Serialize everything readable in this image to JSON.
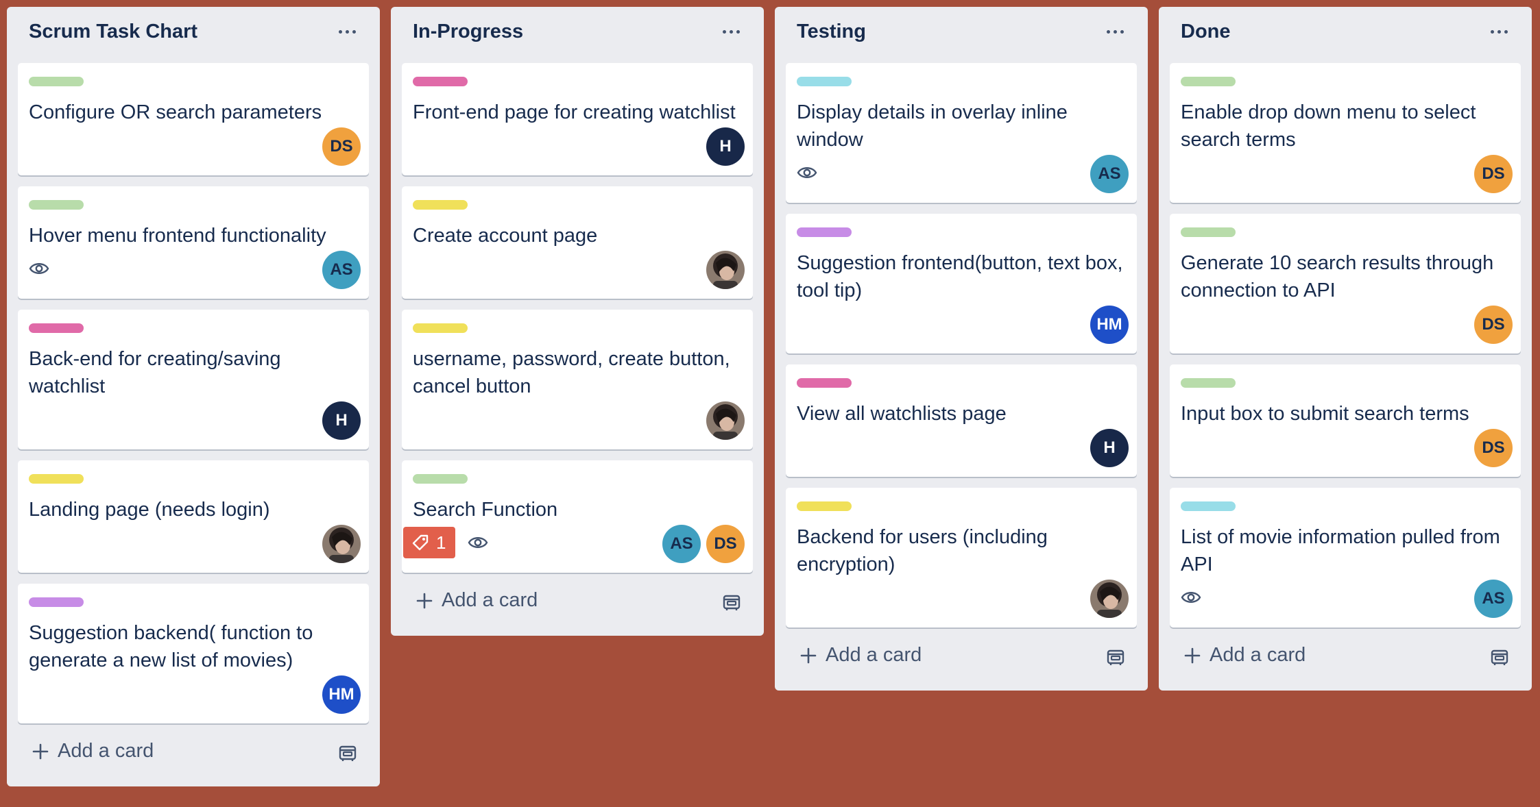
{
  "colors": {
    "background": "#a54e3a",
    "label_green": "#b8dcaa",
    "label_pink": "#e06aa8",
    "label_yellow": "#f0e05a",
    "label_purple": "#c78ce6",
    "label_sky": "#98dde8",
    "avatar_orange": "#f0a13e",
    "avatar_teal": "#3f9fc0",
    "avatar_navy": "#182849",
    "avatar_blue": "#1e4fc8"
  },
  "add_card_label": "Add a card",
  "lists": [
    {
      "title": "Scrum Task Chart",
      "cards": [
        {
          "label_color": "#b8dcaa",
          "title": "Configure OR search parameters",
          "watch": false,
          "members": [
            {
              "initials": "DS",
              "color": "#f0a13e",
              "light": false
            }
          ]
        },
        {
          "label_color": "#b8dcaa",
          "title": "Hover menu frontend functionality",
          "watch": true,
          "members": [
            {
              "initials": "AS",
              "color": "#3f9fc0",
              "light": false
            }
          ]
        },
        {
          "label_color": "#e06aa8",
          "title": "Back-end for creating/saving watchlist",
          "watch": false,
          "members": [
            {
              "initials": "H",
              "color": "#182849",
              "light": true
            }
          ]
        },
        {
          "label_color": "#f0e05a",
          "title": "Landing page (needs login)",
          "watch": false,
          "members": [
            {
              "photo": true
            }
          ]
        },
        {
          "label_color": "#c78ce6",
          "title": "Suggestion backend( function to generate a new list of movies)",
          "watch": false,
          "members": [
            {
              "initials": "HM",
              "color": "#1e4fc8",
              "light": true
            }
          ]
        }
      ]
    },
    {
      "title": "In-Progress",
      "cards": [
        {
          "label_color": "#e06aa8",
          "title": "Front-end page for creating watchlist",
          "watch": false,
          "members": [
            {
              "initials": "H",
              "color": "#182849",
              "light": true
            }
          ]
        },
        {
          "label_color": "#f0e05a",
          "title": "Create account page",
          "watch": false,
          "members": [
            {
              "photo": true
            }
          ]
        },
        {
          "label_color": "#f0e05a",
          "title": "username, password, create button, cancel button",
          "watch": false,
          "members": [
            {
              "photo": true
            }
          ]
        },
        {
          "label_color": "#b8dcaa",
          "title": "Search Function",
          "watch": true,
          "tag_count": "1",
          "members": [
            {
              "initials": "AS",
              "color": "#3f9fc0",
              "light": false
            },
            {
              "initials": "DS",
              "color": "#f0a13e",
              "light": false
            }
          ]
        }
      ]
    },
    {
      "title": "Testing",
      "cards": [
        {
          "label_color": "#98dde8",
          "title": "Display details in overlay inline window",
          "watch": true,
          "members": [
            {
              "initials": "AS",
              "color": "#3f9fc0",
              "light": false
            }
          ]
        },
        {
          "label_color": "#c78ce6",
          "title": "Suggestion frontend(button, text box, tool tip)",
          "watch": false,
          "members": [
            {
              "initials": "HM",
              "color": "#1e4fc8",
              "light": true
            }
          ]
        },
        {
          "label_color": "#e06aa8",
          "title": "View all watchlists page",
          "watch": false,
          "members": [
            {
              "initials": "H",
              "color": "#182849",
              "light": true
            }
          ]
        },
        {
          "label_color": "#f0e05a",
          "title": "Backend for users (including encryption)",
          "watch": false,
          "members": [
            {
              "photo": true
            }
          ]
        }
      ]
    },
    {
      "title": "Done",
      "cards": [
        {
          "label_color": "#b8dcaa",
          "title": "Enable drop down menu to select search terms",
          "watch": false,
          "members": [
            {
              "initials": "DS",
              "color": "#f0a13e",
              "light": false
            }
          ]
        },
        {
          "label_color": "#b8dcaa",
          "title": "Generate 10 search results through connection to API",
          "watch": false,
          "members": [
            {
              "initials": "DS",
              "color": "#f0a13e",
              "light": false
            }
          ]
        },
        {
          "label_color": "#b8dcaa",
          "title": "Input box to submit search terms",
          "watch": false,
          "members": [
            {
              "initials": "DS",
              "color": "#f0a13e",
              "light": false
            }
          ]
        },
        {
          "label_color": "#98dde8",
          "title": "List of movie information pulled from API",
          "watch": true,
          "members": [
            {
              "initials": "AS",
              "color": "#3f9fc0",
              "light": false
            }
          ]
        }
      ]
    }
  ]
}
